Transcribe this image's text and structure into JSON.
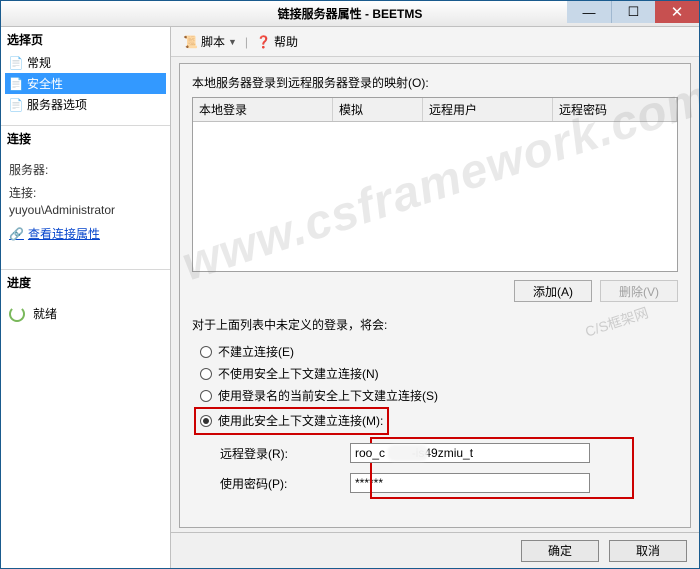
{
  "titlebar": {
    "title": "链接服务器属性 - BEETMS"
  },
  "sidebar": {
    "select_header": "选择页",
    "items": [
      {
        "label": "常规"
      },
      {
        "label": "安全性"
      },
      {
        "label": "服务器选项"
      }
    ],
    "conn_header": "连接",
    "server_label": "服务器:",
    "server_value": " ",
    "connection_label": "连接:",
    "connection_value": "yuyou\\Administrator",
    "view_conn_link": "查看连接属性",
    "progress_header": "进度",
    "progress_status": "就绪"
  },
  "toolbar": {
    "script": "脚本",
    "help": "帮助"
  },
  "main": {
    "mapping_label": "本地服务器登录到远程服务器登录的映射(O):",
    "columns": {
      "c1": "本地登录",
      "c2": "模拟",
      "c3": "远程用户",
      "c4": "远程密码"
    },
    "add_btn": "添加(A)",
    "remove_btn": "删除(V)",
    "undef_label": "对于上面列表中未定义的登录，将会:",
    "radios": {
      "r1": "不建立连接(E)",
      "r2": "不使用安全上下文建立连接(N)",
      "r3": "使用登录名的当前安全上下文建立连接(S)",
      "r4": "使用此安全上下文建立连接(M):"
    },
    "remote_login_label": "远程登录(R):",
    "remote_login_value": "roo_c        -is49zmiu_t",
    "password_label": "使用密码(P):",
    "password_value": "******"
  },
  "footer": {
    "ok": "确定",
    "cancel": "取消"
  },
  "watermark": {
    "big": "www.csframework.com",
    "small": "C/S框架网"
  }
}
